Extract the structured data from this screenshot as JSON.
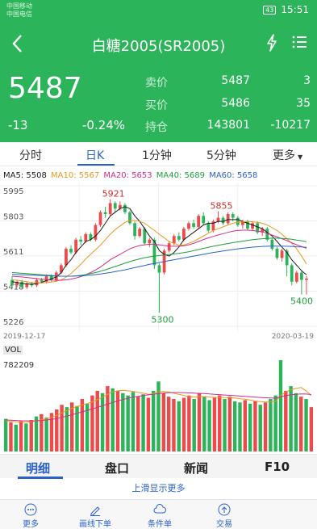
{
  "status": {
    "carrier1": "中国移动",
    "carrier2": "中国电信",
    "battery": "43",
    "time": "15:51"
  },
  "header": {
    "title": "白糖2005(SR2005)"
  },
  "quote": {
    "price": "5487",
    "change": "-13",
    "change_pct": "-0.24%",
    "sell_label": "卖价",
    "sell_price": "5487",
    "sell_vol": "3",
    "buy_label": "买价",
    "buy_price": "5486",
    "buy_vol": "35",
    "hold_label": "持仓",
    "hold_value": "143801",
    "hold_change": "-10217"
  },
  "tabs": [
    "分时",
    "日K",
    "1分钟",
    "5分钟",
    "更多"
  ],
  "active_tab": 1,
  "ma": [
    {
      "label": "MA5: 5508",
      "color": "#1b1b1b"
    },
    {
      "label": "MA10: 5567",
      "color": "#e89a1c"
    },
    {
      "label": "MA20: 5653",
      "color": "#d42b8a"
    },
    {
      "label": "MA40: 5689",
      "color": "#1f9e3c"
    },
    {
      "label": "MA60: 5658",
      "color": "#2a62c9"
    }
  ],
  "chart_data": {
    "type": "candlestick",
    "price_ticks": [
      "5995",
      "5803",
      "5611",
      "5418",
      "5226"
    ],
    "ylim": [
      5226,
      5995
    ],
    "x_start": "2019-12-17",
    "x_end": "2020-03-19",
    "annotations": {
      "high": "5921",
      "mid_high": "5855",
      "low": "5300",
      "last_low": "5400"
    },
    "candles": [
      [
        5480,
        5450,
        5500,
        5440
      ],
      [
        5450,
        5470,
        5480,
        5440
      ],
      [
        5470,
        5440,
        5480,
        5430
      ],
      [
        5440,
        5460,
        5470,
        5430
      ],
      [
        5460,
        5450,
        5470,
        5440
      ],
      [
        5450,
        5480,
        5490,
        5440
      ],
      [
        5480,
        5470,
        5490,
        5460
      ],
      [
        5470,
        5500,
        5510,
        5460
      ],
      [
        5500,
        5480,
        5510,
        5470
      ],
      [
        5480,
        5520,
        5530,
        5470
      ],
      [
        5520,
        5560,
        5570,
        5510
      ],
      [
        5560,
        5650,
        5660,
        5550
      ],
      [
        5650,
        5630,
        5670,
        5620
      ],
      [
        5630,
        5700,
        5710,
        5620
      ],
      [
        5700,
        5690,
        5720,
        5670
      ],
      [
        5690,
        5730,
        5740,
        5680
      ],
      [
        5730,
        5700,
        5740,
        5690
      ],
      [
        5700,
        5780,
        5790,
        5690
      ],
      [
        5780,
        5850,
        5860,
        5770
      ],
      [
        5850,
        5840,
        5880,
        5820
      ],
      [
        5840,
        5900,
        5921,
        5830
      ],
      [
        5900,
        5870,
        5910,
        5850
      ],
      [
        5870,
        5890,
        5910,
        5860
      ],
      [
        5890,
        5850,
        5900,
        5840
      ],
      [
        5850,
        5790,
        5860,
        5780
      ],
      [
        5790,
        5720,
        5800,
        5700
      ],
      [
        5720,
        5760,
        5770,
        5710
      ],
      [
        5760,
        5680,
        5770,
        5670
      ],
      [
        5680,
        5700,
        5710,
        5660
      ],
      [
        5700,
        5560,
        5710,
        5540
      ],
      [
        5560,
        5520,
        5570,
        5300
      ],
      [
        5520,
        5640,
        5650,
        5510
      ],
      [
        5640,
        5680,
        5690,
        5630
      ],
      [
        5680,
        5720,
        5730,
        5670
      ],
      [
        5720,
        5700,
        5740,
        5690
      ],
      [
        5700,
        5760,
        5770,
        5690
      ],
      [
        5760,
        5790,
        5800,
        5750
      ],
      [
        5790,
        5770,
        5810,
        5760
      ],
      [
        5770,
        5830,
        5840,
        5760
      ],
      [
        5830,
        5790,
        5850,
        5780
      ],
      [
        5790,
        5750,
        5800,
        5740
      ],
      [
        5750,
        5800,
        5810,
        5740
      ],
      [
        5800,
        5820,
        5855,
        5790
      ],
      [
        5820,
        5790,
        5830,
        5780
      ],
      [
        5790,
        5840,
        5850,
        5780
      ],
      [
        5840,
        5820,
        5850,
        5800
      ],
      [
        5820,
        5780,
        5830,
        5770
      ],
      [
        5780,
        5800,
        5810,
        5760
      ],
      [
        5800,
        5760,
        5810,
        5750
      ],
      [
        5760,
        5790,
        5800,
        5750
      ],
      [
        5790,
        5740,
        5800,
        5730
      ],
      [
        5740,
        5760,
        5770,
        5720
      ],
      [
        5760,
        5700,
        5770,
        5690
      ],
      [
        5700,
        5650,
        5710,
        5640
      ],
      [
        5650,
        5600,
        5660,
        5590
      ],
      [
        5600,
        5640,
        5650,
        5580
      ],
      [
        5640,
        5560,
        5650,
        5500
      ],
      [
        5560,
        5470,
        5570,
        5450
      ],
      [
        5470,
        5520,
        5530,
        5460
      ],
      [
        5520,
        5480,
        5530,
        5400
      ],
      [
        5480,
        5487,
        5500,
        5400
      ]
    ],
    "ma_series": {
      "MA5": [
        5470,
        5466,
        5460,
        5458,
        5456,
        5460,
        5466,
        5476,
        5486,
        5496,
        5520,
        5560,
        5590,
        5630,
        5660,
        5690,
        5700,
        5720,
        5750,
        5790,
        5830,
        5850,
        5870,
        5880,
        5870,
        5830,
        5800,
        5760,
        5720,
        5690,
        5640,
        5620,
        5610,
        5630,
        5660,
        5700,
        5720,
        5740,
        5760,
        5780,
        5790,
        5790,
        5800,
        5800,
        5810,
        5810,
        5810,
        5800,
        5790,
        5780,
        5770,
        5760,
        5740,
        5720,
        5690,
        5660,
        5630,
        5590,
        5560,
        5530,
        5508
      ],
      "MA10": [
        5480,
        5478,
        5474,
        5470,
        5466,
        5464,
        5463,
        5465,
        5468,
        5472,
        5480,
        5495,
        5515,
        5540,
        5565,
        5595,
        5620,
        5645,
        5670,
        5700,
        5730,
        5755,
        5775,
        5795,
        5805,
        5805,
        5800,
        5790,
        5770,
        5750,
        5730,
        5710,
        5690,
        5680,
        5670,
        5670,
        5680,
        5690,
        5705,
        5720,
        5735,
        5750,
        5760,
        5770,
        5780,
        5790,
        5795,
        5798,
        5800,
        5798,
        5795,
        5790,
        5780,
        5765,
        5750,
        5730,
        5705,
        5680,
        5650,
        5610,
        5567
      ],
      "MA20": [
        5500,
        5498,
        5496,
        5493,
        5490,
        5487,
        5484,
        5481,
        5479,
        5478,
        5478,
        5480,
        5484,
        5490,
        5498,
        5508,
        5520,
        5534,
        5550,
        5570,
        5590,
        5605,
        5620,
        5635,
        5650,
        5660,
        5668,
        5672,
        5675,
        5675,
        5672,
        5668,
        5665,
        5664,
        5664,
        5667,
        5672,
        5680,
        5690,
        5700,
        5710,
        5718,
        5726,
        5733,
        5740,
        5746,
        5750,
        5752,
        5752,
        5750,
        5747,
        5742,
        5735,
        5725,
        5715,
        5705,
        5695,
        5683,
        5672,
        5662,
        5653
      ],
      "MA40": [
        5520,
        5518,
        5516,
        5514,
        5512,
        5510,
        5508,
        5506,
        5504,
        5502,
        5500,
        5500,
        5500,
        5502,
        5505,
        5509,
        5514,
        5520,
        5527,
        5535,
        5544,
        5553,
        5562,
        5571,
        5580,
        5588,
        5595,
        5601,
        5606,
        5610,
        5613,
        5616,
        5619,
        5622,
        5625,
        5629,
        5634,
        5640,
        5646,
        5652,
        5658,
        5664,
        5669,
        5674,
        5679,
        5684,
        5688,
        5692,
        5696,
        5700,
        5703,
        5705,
        5707,
        5708,
        5708,
        5707,
        5705,
        5702,
        5698,
        5694,
        5689
      ],
      "MA60": [
        5510,
        5509,
        5508,
        5507,
        5506,
        5505,
        5504,
        5503,
        5502,
        5501,
        5500,
        5500,
        5500,
        5501,
        5502,
        5504,
        5506,
        5509,
        5512,
        5516,
        5520,
        5525,
        5530,
        5535,
        5541,
        5547,
        5553,
        5559,
        5565,
        5570,
        5575,
        5580,
        5585,
        5590,
        5595,
        5600,
        5605,
        5610,
        5615,
        5620,
        5625,
        5630,
        5634,
        5638,
        5642,
        5646,
        5650,
        5653,
        5656,
        5659,
        5661,
        5663,
        5664,
        5665,
        5665,
        5665,
        5664,
        5663,
        5661,
        5660,
        5658
      ]
    },
    "volume": {
      "max_label": "782209",
      "ymax": 782209,
      "values": [
        280000,
        250000,
        230000,
        260000,
        240000,
        270000,
        300000,
        320000,
        290000,
        330000,
        360000,
        400000,
        380000,
        420000,
        390000,
        450000,
        410000,
        480000,
        520000,
        500000,
        560000,
        540000,
        520000,
        500000,
        480000,
        510000,
        470000,
        490000,
        460000,
        520000,
        600000,
        500000,
        470000,
        450000,
        430000,
        460000,
        480000,
        450000,
        500000,
        470000,
        440000,
        460000,
        480000,
        450000,
        470000,
        430000,
        420000,
        440000,
        410000,
        430000,
        400000,
        420000,
        450000,
        480000,
        782209,
        520000,
        560000,
        500000,
        470000,
        450000,
        380000
      ],
      "ma_lines": {
        "fast": [
          260000,
          260000,
          255000,
          253000,
          252000,
          256000,
          262000,
          272000,
          280000,
          292000,
          310000,
          330000,
          350000,
          370000,
          385000,
          400000,
          410000,
          425000,
          445000,
          465000,
          490000,
          510000,
          520000,
          525000,
          520000,
          515000,
          505000,
          500000,
          490000,
          495000,
          510000,
          515000,
          510000,
          500000,
          490000,
          480000,
          470000,
          465000,
          468000,
          470000,
          465000,
          463000,
          465000,
          462000,
          460000,
          458000,
          452000,
          448000,
          440000,
          432000,
          428000,
          424000,
          425000,
          430000,
          480000,
          510000,
          530000,
          540000,
          548000,
          520000,
          480000
        ],
        "slow": [
          270000,
          268000,
          266000,
          264000,
          263000,
          262000,
          263000,
          266000,
          270000,
          275000,
          282000,
          292000,
          303000,
          315000,
          327000,
          340000,
          352000,
          365000,
          378000,
          392000,
          406000,
          420000,
          433000,
          445000,
          456000,
          465000,
          473000,
          480000,
          485000,
          490000,
          496000,
          500000,
          503000,
          505000,
          505000,
          504000,
          502000,
          500000,
          498000,
          496000,
          493000,
          490000,
          487000,
          484000,
          481000,
          478000,
          475000,
          472000,
          469000,
          466000,
          463000,
          460000,
          458000,
          457000,
          470000,
          478000,
          485000,
          490000,
          493000,
          492000,
          488000
        ]
      }
    }
  },
  "vol_label": "VOL",
  "bottom_tabs": [
    "明细",
    "盘口",
    "新闻",
    "F10"
  ],
  "more_hint": "上滑显示更多",
  "toolbar": [
    "更多",
    "画线下单",
    "条件单",
    "交易"
  ]
}
